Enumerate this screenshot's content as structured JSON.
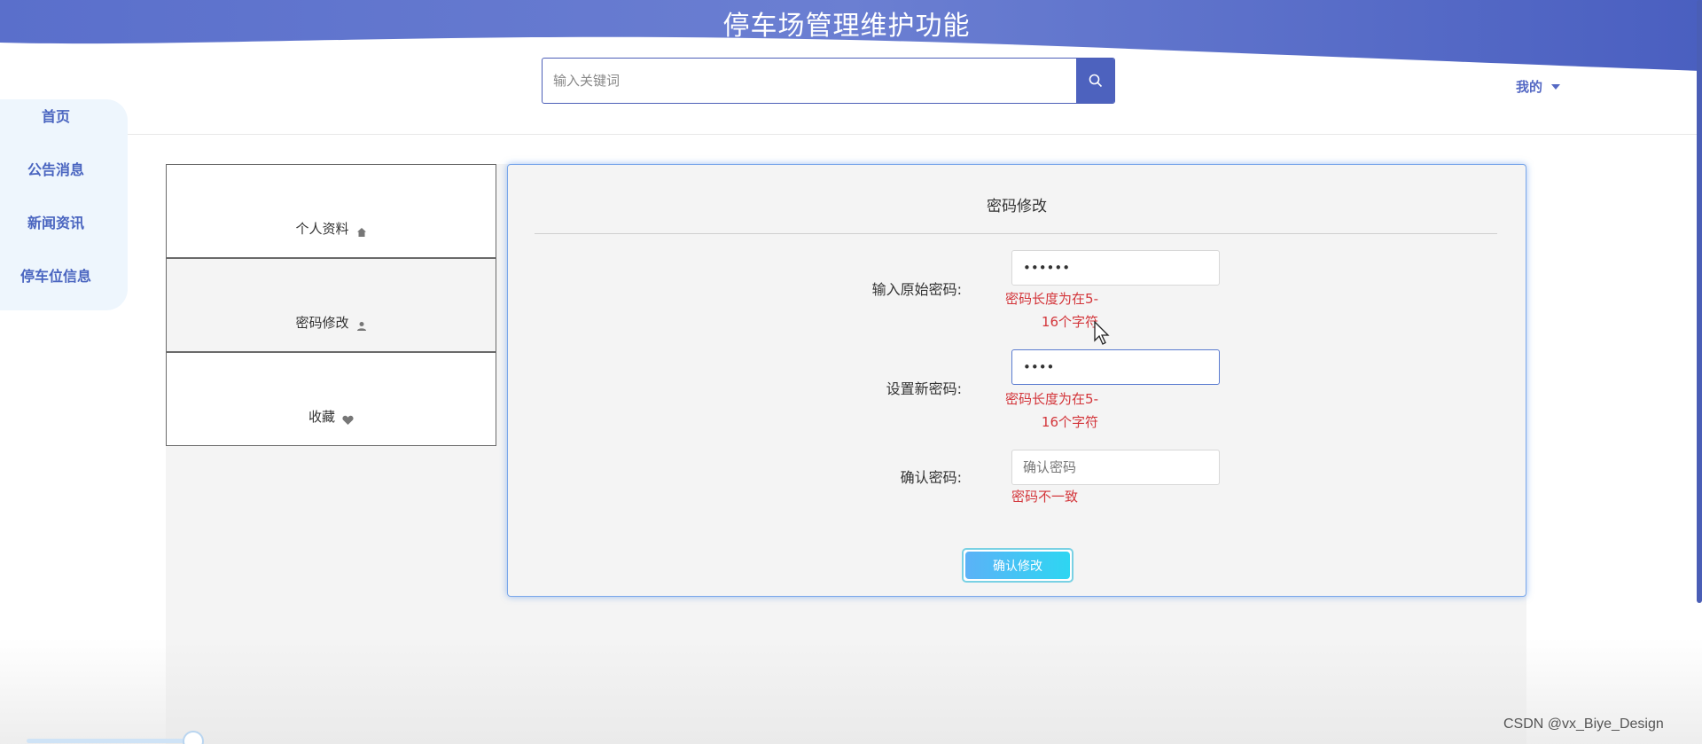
{
  "header": {
    "title": "停车场管理维护功能",
    "search_placeholder": "输入关键词",
    "user_menu_label": "我的",
    "wave_color": "#5b6fc9"
  },
  "sidebar": {
    "items": [
      {
        "label": "首页"
      },
      {
        "label": "公告消息"
      },
      {
        "label": "新闻资讯"
      },
      {
        "label": "停车位信息"
      }
    ]
  },
  "tabs": [
    {
      "label": "个人资料",
      "icon": "home-icon",
      "active": false
    },
    {
      "label": "密码修改",
      "icon": "user-icon",
      "active": true
    },
    {
      "label": "收藏",
      "icon": "heart-icon",
      "active": false
    }
  ],
  "form": {
    "title": "密码修改",
    "fields": [
      {
        "label": "输入原始密码:",
        "value": "••••••",
        "placeholder": "",
        "error_line1": "密码长度为在5-",
        "error_line2": "16个字符"
      },
      {
        "label": "设置新密码:",
        "value": "••••",
        "placeholder": "",
        "error_line1": "密码长度为在5-",
        "error_line2": "16个字符"
      },
      {
        "label": "确认密码:",
        "value": "",
        "placeholder": "确认密码",
        "error_line1": "密码不一致"
      }
    ],
    "submit_label": "确认修改"
  },
  "watermark": "CSDN @vx_Biye_Design",
  "colors": {
    "accent": "#4d62be",
    "nav_text": "#4a65c0",
    "error": "#d3353a",
    "button_gradient_start": "#5bb2f7",
    "button_gradient_end": "#2ed6f2"
  }
}
